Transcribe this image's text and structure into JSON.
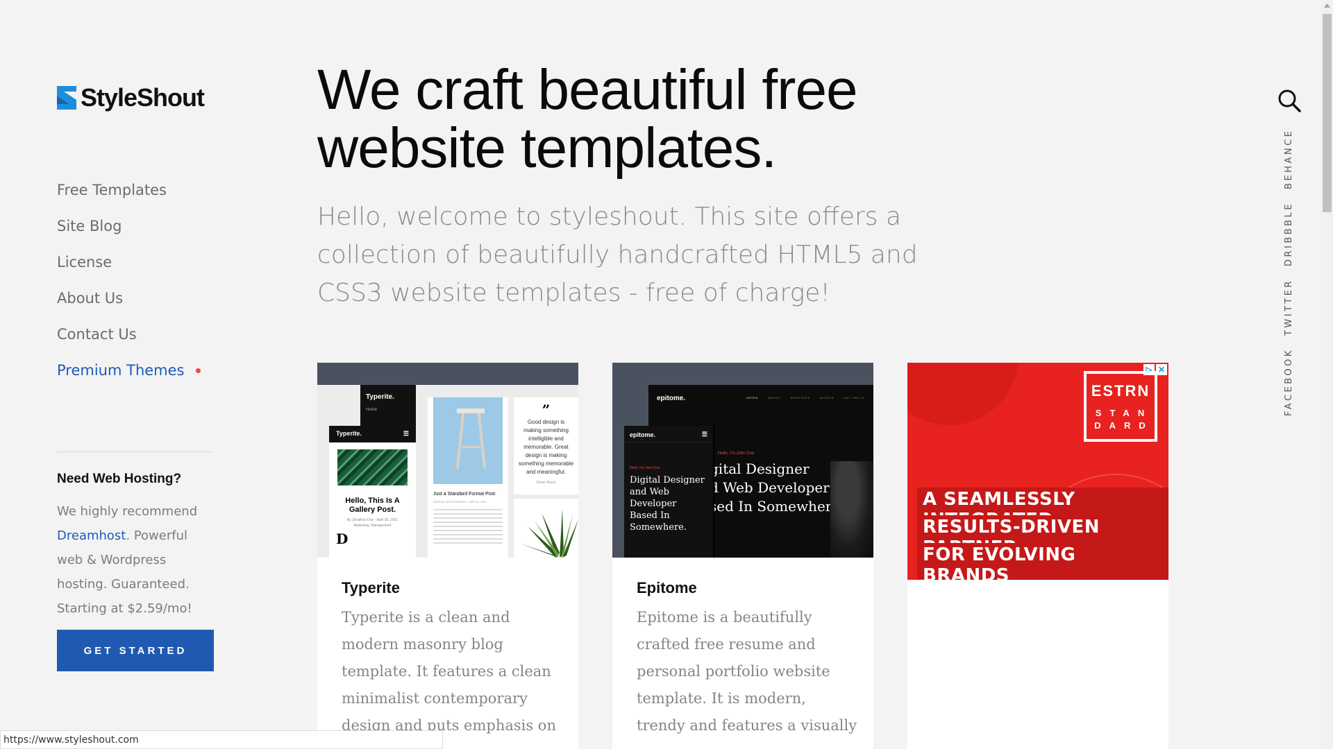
{
  "brand": {
    "name": "StyleShout",
    "accent": "#2059b0",
    "mark_color": "#1b8fd8"
  },
  "nav": {
    "items": [
      {
        "label": "Free Templates"
      },
      {
        "label": "Site Blog"
      },
      {
        "label": "License"
      },
      {
        "label": "About Us"
      },
      {
        "label": "Contact Us"
      },
      {
        "label": "Premium Themes"
      }
    ]
  },
  "hosting": {
    "title": "Need Web Hosting?",
    "text_before": "We highly recommend ",
    "link": "Dreamhost",
    "text_after": ". Powerful web & Wordpress hosting. Guaranteed. Starting at $2.59/mo!",
    "cta": "GET STARTED"
  },
  "hero": {
    "title": "We craft beautiful free website templates.",
    "subtitle": "Hello, welcome to styleshout. This site offers a collection of beautifully handcrafted HTML5 and CSS3 website templates - free of charge!"
  },
  "cards": [
    {
      "title": "Typerite",
      "desc": "Typerite is a clean and modern masonry blog template. It features a clean minimalist contemporary design and puts emphasis on ...",
      "thumb": {
        "brand": "Typerite.",
        "nav_home": "Home",
        "post_title": "Hello, This Is A Gallery Post.",
        "post_meta": "By Jonathan Doe · April 30, 2021",
        "post_tag": "Marketing, Management",
        "post_drop": "D",
        "mid_title": "Just a Standard Format Post.",
        "mid_meta": "DESIGN, PHOTOGRAPHY · APR 29, 2021",
        "quote_mark": "”",
        "quote": "Good design is making something intelligible and memorable. Great design is making something memorable and meaningful.",
        "quote_author": "Dieter Rams"
      }
    },
    {
      "title": "Epitome",
      "desc": "Epitome is a beautifully crafted free resume and personal portfolio website template. It is modern, trendy and features a visually ...",
      "thumb": {
        "brand": "epitome.",
        "nav": [
          "INTRO",
          "ABOUT",
          "SERVICES",
          "WORKS",
          "SAY HELLO"
        ],
        "hello": "Hello, I'm John Doe",
        "headline_lines": [
          "gital Designer",
          "d Web Developer",
          "sed In Somewhere."
        ],
        "mobile_lines": [
          "Digital Designer",
          "and Web",
          "Developer",
          "Based In",
          "Somewhere."
        ]
      }
    }
  ],
  "ad": {
    "badge_top": "ESTRN",
    "badge_bottom": "STAN DARD",
    "lines": [
      "A SEAMLESSLY INTEGRATED,",
      "RESULTS-DRIVEN PARTNER",
      "FOR EVOLVING BRANDS"
    ],
    "color": "#e8221f"
  },
  "social": [
    "FACEBOOK",
    "TWITTER",
    "DRIBBBLE",
    "BEHANCE"
  ],
  "status_url": "https://www.styleshout.com"
}
